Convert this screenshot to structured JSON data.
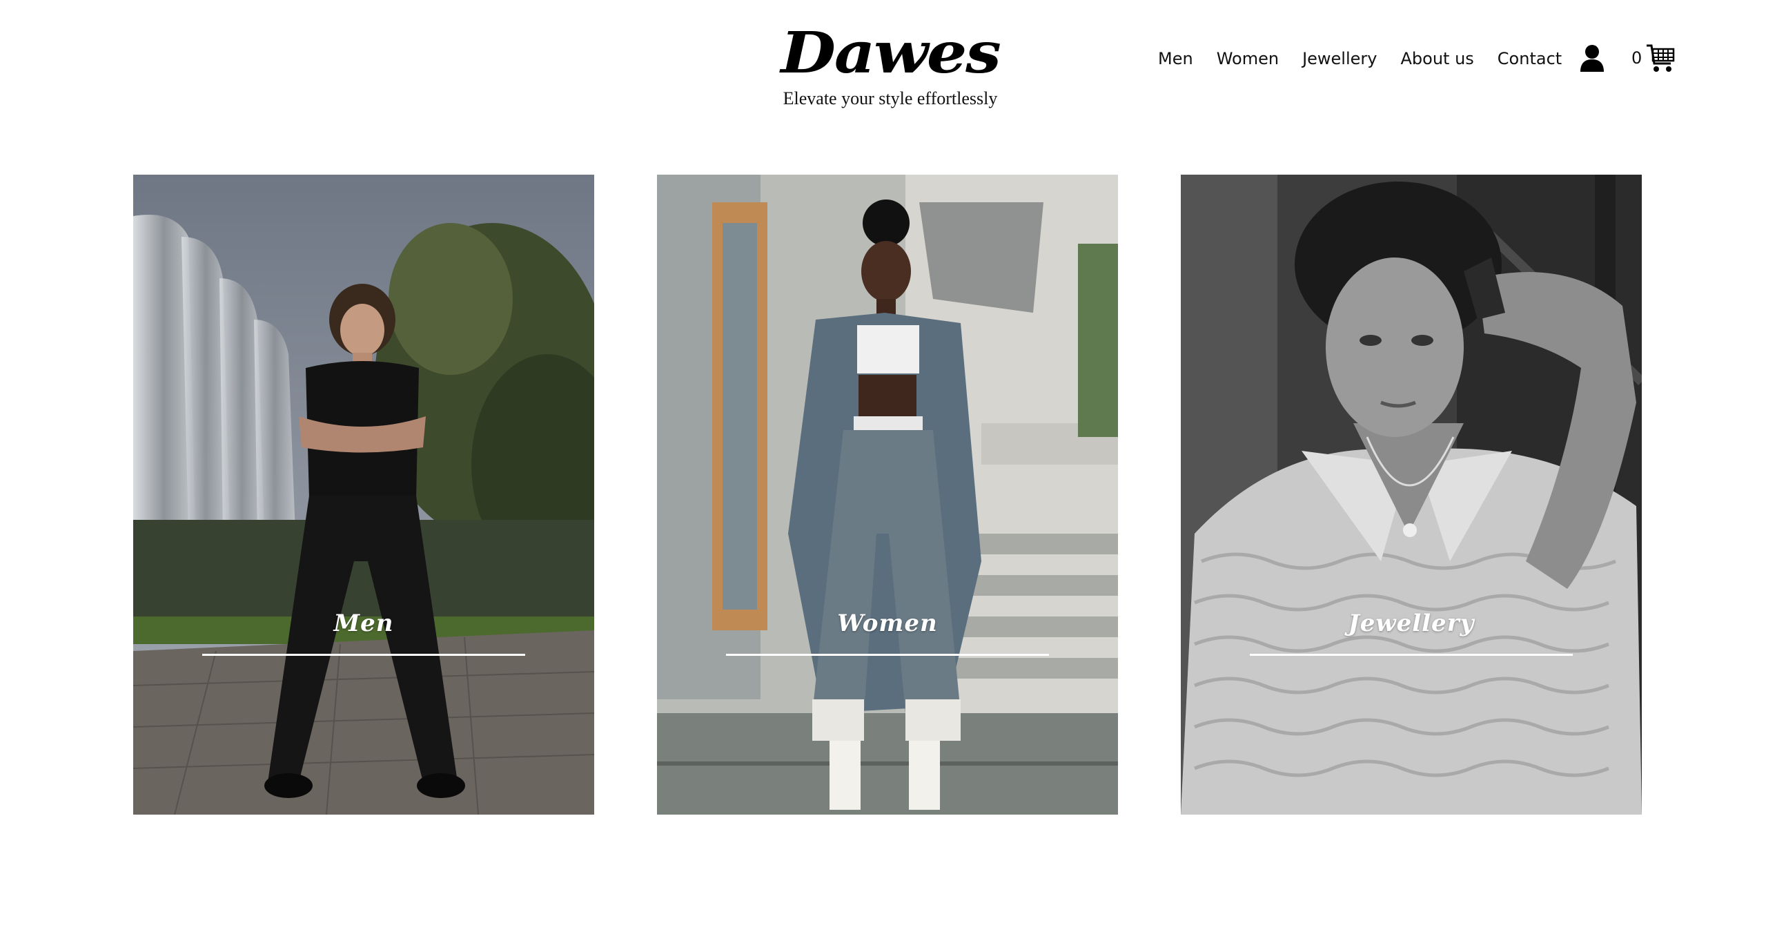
{
  "brand": {
    "name": "Dawes",
    "tagline": "Elevate your style effortlessly"
  },
  "nav": {
    "links": [
      "Men",
      "Women",
      "Jewellery",
      "About us",
      "Contact"
    ],
    "cart_count": "0",
    "account_icon": "user-icon",
    "cart_icon": "cart-icon"
  },
  "categories": [
    {
      "label": "Men",
      "photo": "young man in black t-shirt and wide black jeans, arms crossed, outdoors beside a metallic building"
    },
    {
      "label": "Women",
      "photo": "woman in grey-blue coat and wide trousers with lace hems, standing on stone steps"
    },
    {
      "label": "Jewellery",
      "photo": "black and white portrait of young man in textured shirt wearing a pendant necklace"
    }
  ],
  "colors": {
    "background": "#ffffff",
    "text": "#111111",
    "label": "#ffffff"
  }
}
